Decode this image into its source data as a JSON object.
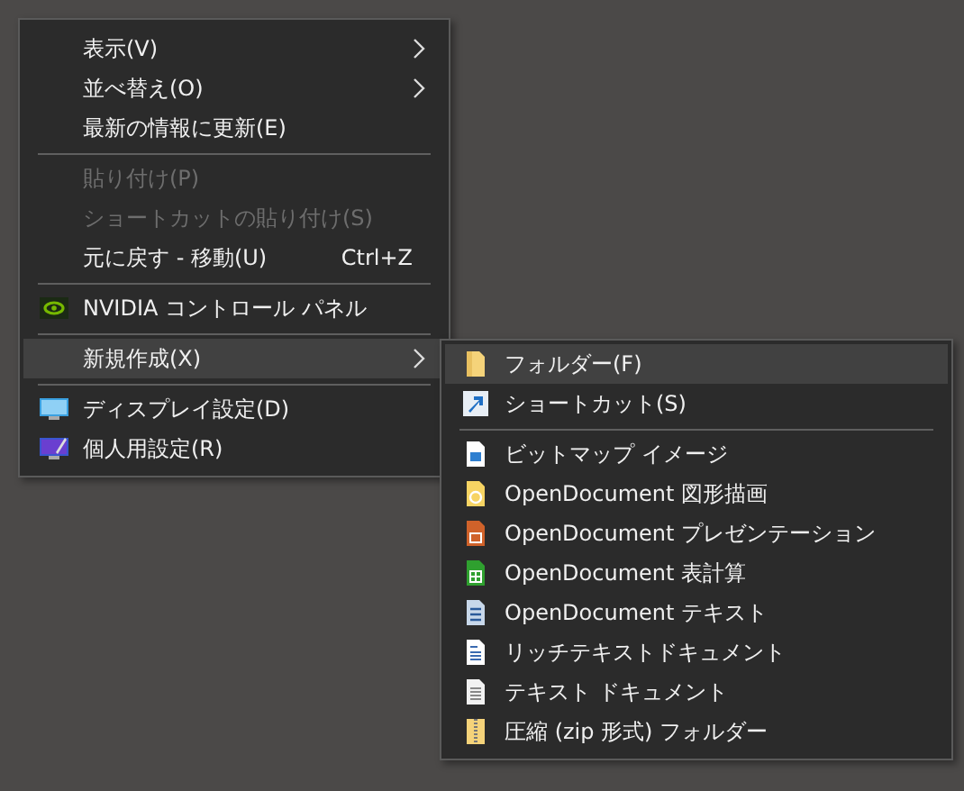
{
  "context_menu": {
    "items": [
      {
        "kind": "item",
        "label": "表示(V)",
        "submenu": true,
        "disabled": false,
        "selected": false
      },
      {
        "kind": "item",
        "label": "並べ替え(O)",
        "submenu": true,
        "disabled": false,
        "selected": false
      },
      {
        "kind": "item",
        "label": "最新の情報に更新(E)",
        "disabled": false,
        "selected": false
      },
      {
        "kind": "separator"
      },
      {
        "kind": "item",
        "label": "貼り付け(P)",
        "disabled": true,
        "selected": false
      },
      {
        "kind": "item",
        "label": "ショートカットの貼り付け(S)",
        "disabled": true,
        "selected": false
      },
      {
        "kind": "item",
        "label": "元に戻す - 移動(U)",
        "shortcut": "Ctrl+Z",
        "disabled": false,
        "selected": false
      },
      {
        "kind": "separator"
      },
      {
        "kind": "item",
        "label": "NVIDIA コントロール パネル",
        "disabled": false,
        "selected": false
      },
      {
        "kind": "separator"
      },
      {
        "kind": "item",
        "label": "新規作成(X)",
        "submenu": true,
        "disabled": false,
        "selected": true
      },
      {
        "kind": "separator"
      },
      {
        "kind": "item",
        "label": "ディスプレイ設定(D)",
        "disabled": false,
        "selected": false
      },
      {
        "kind": "item",
        "label": "個人用設定(R)",
        "disabled": false,
        "selected": false
      }
    ]
  },
  "new_submenu": {
    "items": [
      {
        "kind": "item",
        "label": "フォルダー(F)",
        "selected": true
      },
      {
        "kind": "item",
        "label": "ショートカット(S)",
        "selected": false
      },
      {
        "kind": "separator"
      },
      {
        "kind": "item",
        "label": "ビットマップ イメージ",
        "selected": false
      },
      {
        "kind": "item",
        "label": "OpenDocument 図形描画",
        "selected": false
      },
      {
        "kind": "item",
        "label": "OpenDocument プレゼンテーション",
        "selected": false
      },
      {
        "kind": "item",
        "label": "OpenDocument 表計算",
        "selected": false
      },
      {
        "kind": "item",
        "label": "OpenDocument テキスト",
        "selected": false
      },
      {
        "kind": "item",
        "label": "リッチテキストドキュメント",
        "selected": false
      },
      {
        "kind": "item",
        "label": "テキスト ドキュメント",
        "selected": false
      },
      {
        "kind": "item",
        "label": "圧縮 (zip 形式) フォルダー",
        "selected": false
      }
    ]
  }
}
